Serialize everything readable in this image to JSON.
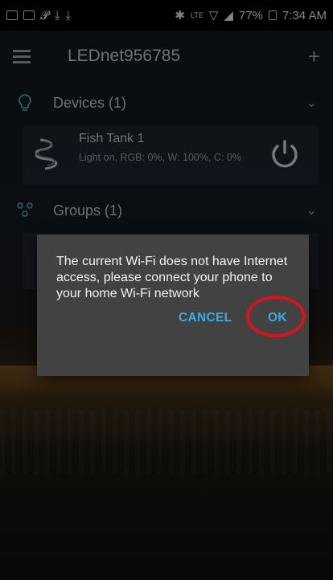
{
  "status_bar": {
    "battery": "77%",
    "time": "7:34 AM",
    "network": "LTE"
  },
  "app_bar": {
    "title": "LEDnet956785",
    "add_icon": "+"
  },
  "sections": {
    "devices": {
      "label": "Devices (1)"
    },
    "groups": {
      "label": "Groups (1)"
    }
  },
  "device": {
    "name": "Fish Tank 1",
    "status": "Light on, RGB: 0%, W: 100%, C: 0%"
  },
  "dialog": {
    "message": "The current Wi-Fi does not have Internet access, please connect your phone to your home Wi-Fi network",
    "cancel_label": "CANCEL",
    "ok_label": "OK",
    "highlight_color": "#d8141a"
  },
  "colors": {
    "accent": "#3ca9e2",
    "icon_teal": "#5bb9c8"
  }
}
